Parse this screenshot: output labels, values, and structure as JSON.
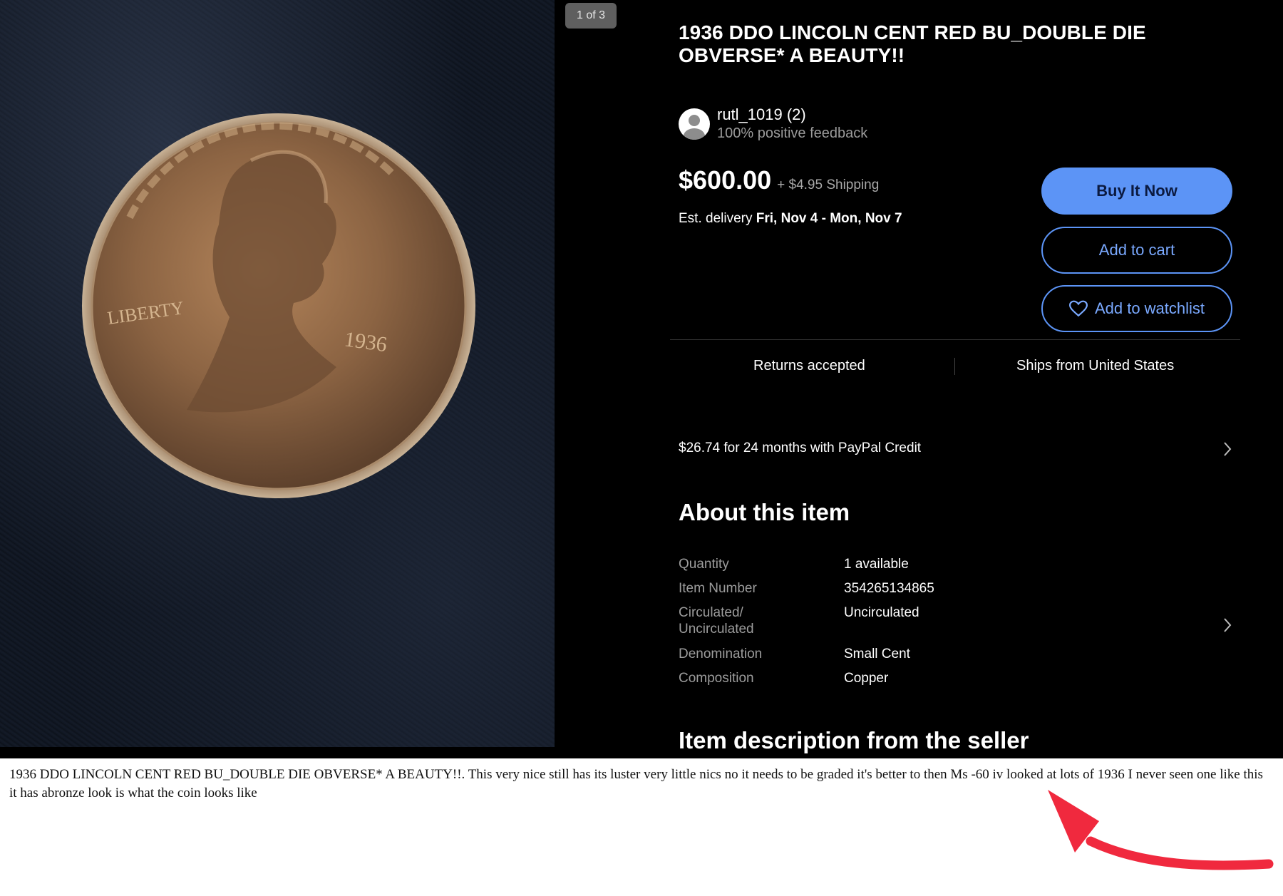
{
  "photo": {
    "counter": "1 of 3"
  },
  "listing": {
    "title": "1936 DDO LINCOLN CENT RED BU_DOUBLE DIE OBVERSE* A BEAUTY!!",
    "seller_name": "rutl_1019 (2)",
    "seller_feedback": "100% positive feedback",
    "price": "$600.00",
    "shipping": "+ $4.95 Shipping",
    "delivery_label": "Est. delivery",
    "delivery_dates": "Fri, Nov 4 - Mon, Nov 7",
    "buy_label": "Buy It Now",
    "cart_label": "Add to cart",
    "watch_label": "Add to watchlist",
    "returns": "Returns accepted",
    "ships_from": "Ships from United States",
    "credit": "$26.74 for 24 months with PayPal Credit"
  },
  "about": {
    "heading": "About this item",
    "specs": [
      {
        "label": "Quantity",
        "value": "1 available"
      },
      {
        "label": "Item Number",
        "value": "354265134865"
      },
      {
        "label": "Circulated/ Uncirculated",
        "value": "Uncirculated"
      },
      {
        "label": "Denomination",
        "value": "Small Cent"
      },
      {
        "label": "Composition",
        "value": "Copper"
      }
    ]
  },
  "description": {
    "heading": "Item description from the seller",
    "text": "1936 DDO LINCOLN CENT RED BU_DOUBLE DIE OBVERSE* A BEAUTY!!. This very nice still has its luster very little nics no it needs to be graded it's better to then Ms -60 iv looked at lots of 1936 I never seen one like this it has abronze look is what the coin looks like"
  },
  "colors": {
    "accent": "#5c94f6",
    "annotation_arrow": "#f0293e"
  }
}
